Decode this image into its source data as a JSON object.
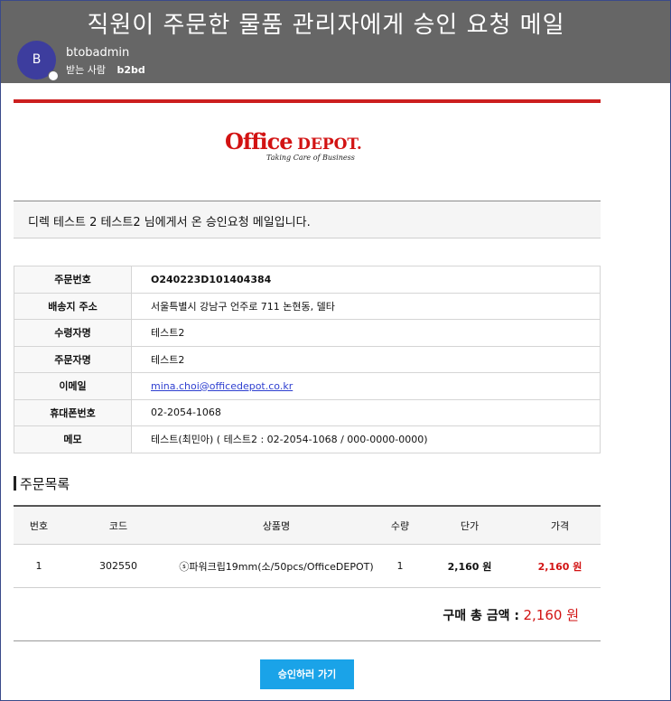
{
  "email": {
    "subject": "직원이 주문한 물품 관리자에게 승인 요청 메일",
    "sender_initial": "B",
    "sender_name": "btobadmin",
    "recipient_label": "받는 사람",
    "recipient_name": "b2bd"
  },
  "logo": {
    "word1": "Office",
    "word2": "DEPOT.",
    "tagline": "Taking Care of Business"
  },
  "intro_text": "디렉 테스트 2 테스트2 님에게서 온 승인요청 메일입니다.",
  "order_info": [
    {
      "label": "주문번호",
      "value": "O240223D101404384"
    },
    {
      "label": "배송지 주소",
      "value": "서울특별시 강남구 언주로 711 논현동, 델타"
    },
    {
      "label": "수령자명",
      "value": "테스트2"
    },
    {
      "label": "주문자명",
      "value": "테스트2"
    },
    {
      "label": "이메일",
      "value": "mina.choi@officedepot.co.kr"
    },
    {
      "label": "휴대폰번호",
      "value": "02-2054-1068"
    },
    {
      "label": "메모",
      "value": "테스트(최민아) ( 테스트2 : 02-2054-1068 / 000-0000-0000)"
    }
  ],
  "order_list": {
    "section_title": "주문목록",
    "headers": [
      "번호",
      "코드",
      "상품명",
      "수량",
      "단가",
      "가격"
    ],
    "rows": [
      [
        "1",
        "302550",
        "ⓢ파워크립19mm(소/50pcs/OfficeDEPOT)",
        "1",
        "2,160 원",
        "2,160 원"
      ]
    ]
  },
  "total": {
    "label": "구매 총 금액 :",
    "amount": "2,160 원"
  },
  "approve_button": "승인하러 가기",
  "colors": {
    "brand_red": "#d21313",
    "accent_blue": "#1aa3e8",
    "header_gray": "#666666",
    "avatar": "#3d3d9e"
  }
}
